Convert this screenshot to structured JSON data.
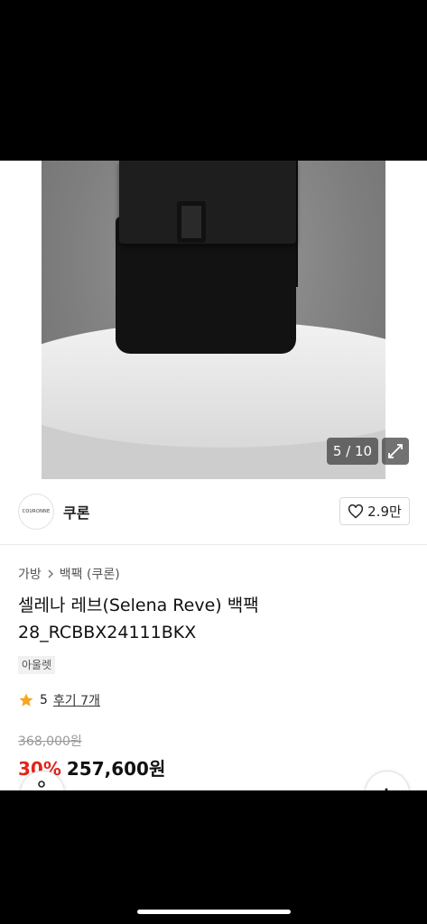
{
  "gallery": {
    "counter": "5 / 10",
    "expand_icon": "expand-icon"
  },
  "brand": {
    "logo_text": "COURONNE",
    "name": "쿠론",
    "like_count": "2.9만",
    "like_icon": "heart-outline-icon"
  },
  "breadcrumb": {
    "items": [
      "가방",
      "백팩 (쿠론)"
    ],
    "separator_icon": "chevron-right-icon"
  },
  "product": {
    "title": "셀레나 레브(Selena Reve) 백팩 28_RCBBX24111BKX",
    "badge": "아울렛",
    "rating": "5",
    "review_link": "후기 7개",
    "original_price": "368,000원",
    "discount": "30%",
    "price": "257,600원"
  },
  "colors": {
    "discount": "#e1251b",
    "star": "#f5a623"
  }
}
